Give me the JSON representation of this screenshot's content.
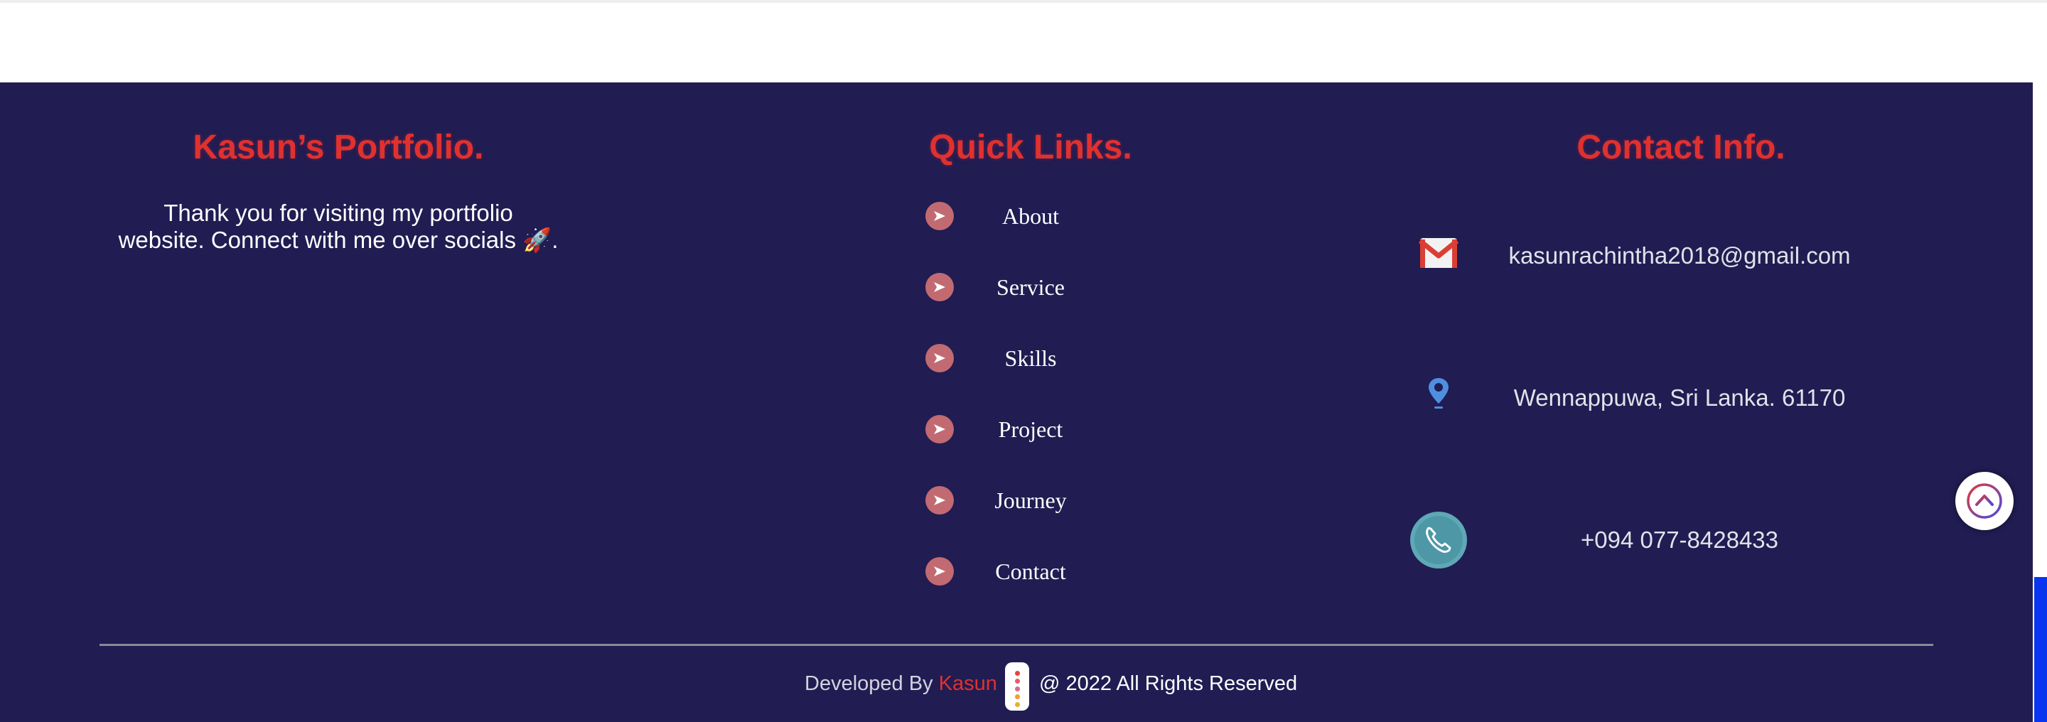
{
  "portfolio": {
    "title": "Kasun’s Portfolio.",
    "line1": "Thank you for visiting my portfolio",
    "line2": "website. Connect with me over socials 🚀."
  },
  "quick_links": {
    "title": "Quick Links.",
    "arrow_icon": "arrow-right-circle-icon",
    "items": [
      {
        "label": "About"
      },
      {
        "label": "Service"
      },
      {
        "label": "Skills"
      },
      {
        "label": "Project"
      },
      {
        "label": "Journey"
      },
      {
        "label": "Contact"
      }
    ]
  },
  "contact": {
    "title": "Contact Info.",
    "email": {
      "icon": "gmail-icon",
      "text": "kasunrachintha2018@gmail.com"
    },
    "location": {
      "icon": "location-pin-icon",
      "text": "Wennappuwa, Sri Lanka. 61170"
    },
    "phone": {
      "icon": "phone-icon",
      "text": "+094 077-8428433"
    }
  },
  "credits": {
    "developed_by": "Developed By ",
    "name": "Kasun",
    "rights": "@ 2022 All Rights Reserved"
  },
  "scroll_top": {
    "icon": "chevron-up-icon"
  },
  "colors": {
    "footer_bg": "#211c52",
    "accent_red": "#e0312f",
    "link_arrow_bg": "#c26a72",
    "scrollbar_blue": "#0a35f0"
  }
}
